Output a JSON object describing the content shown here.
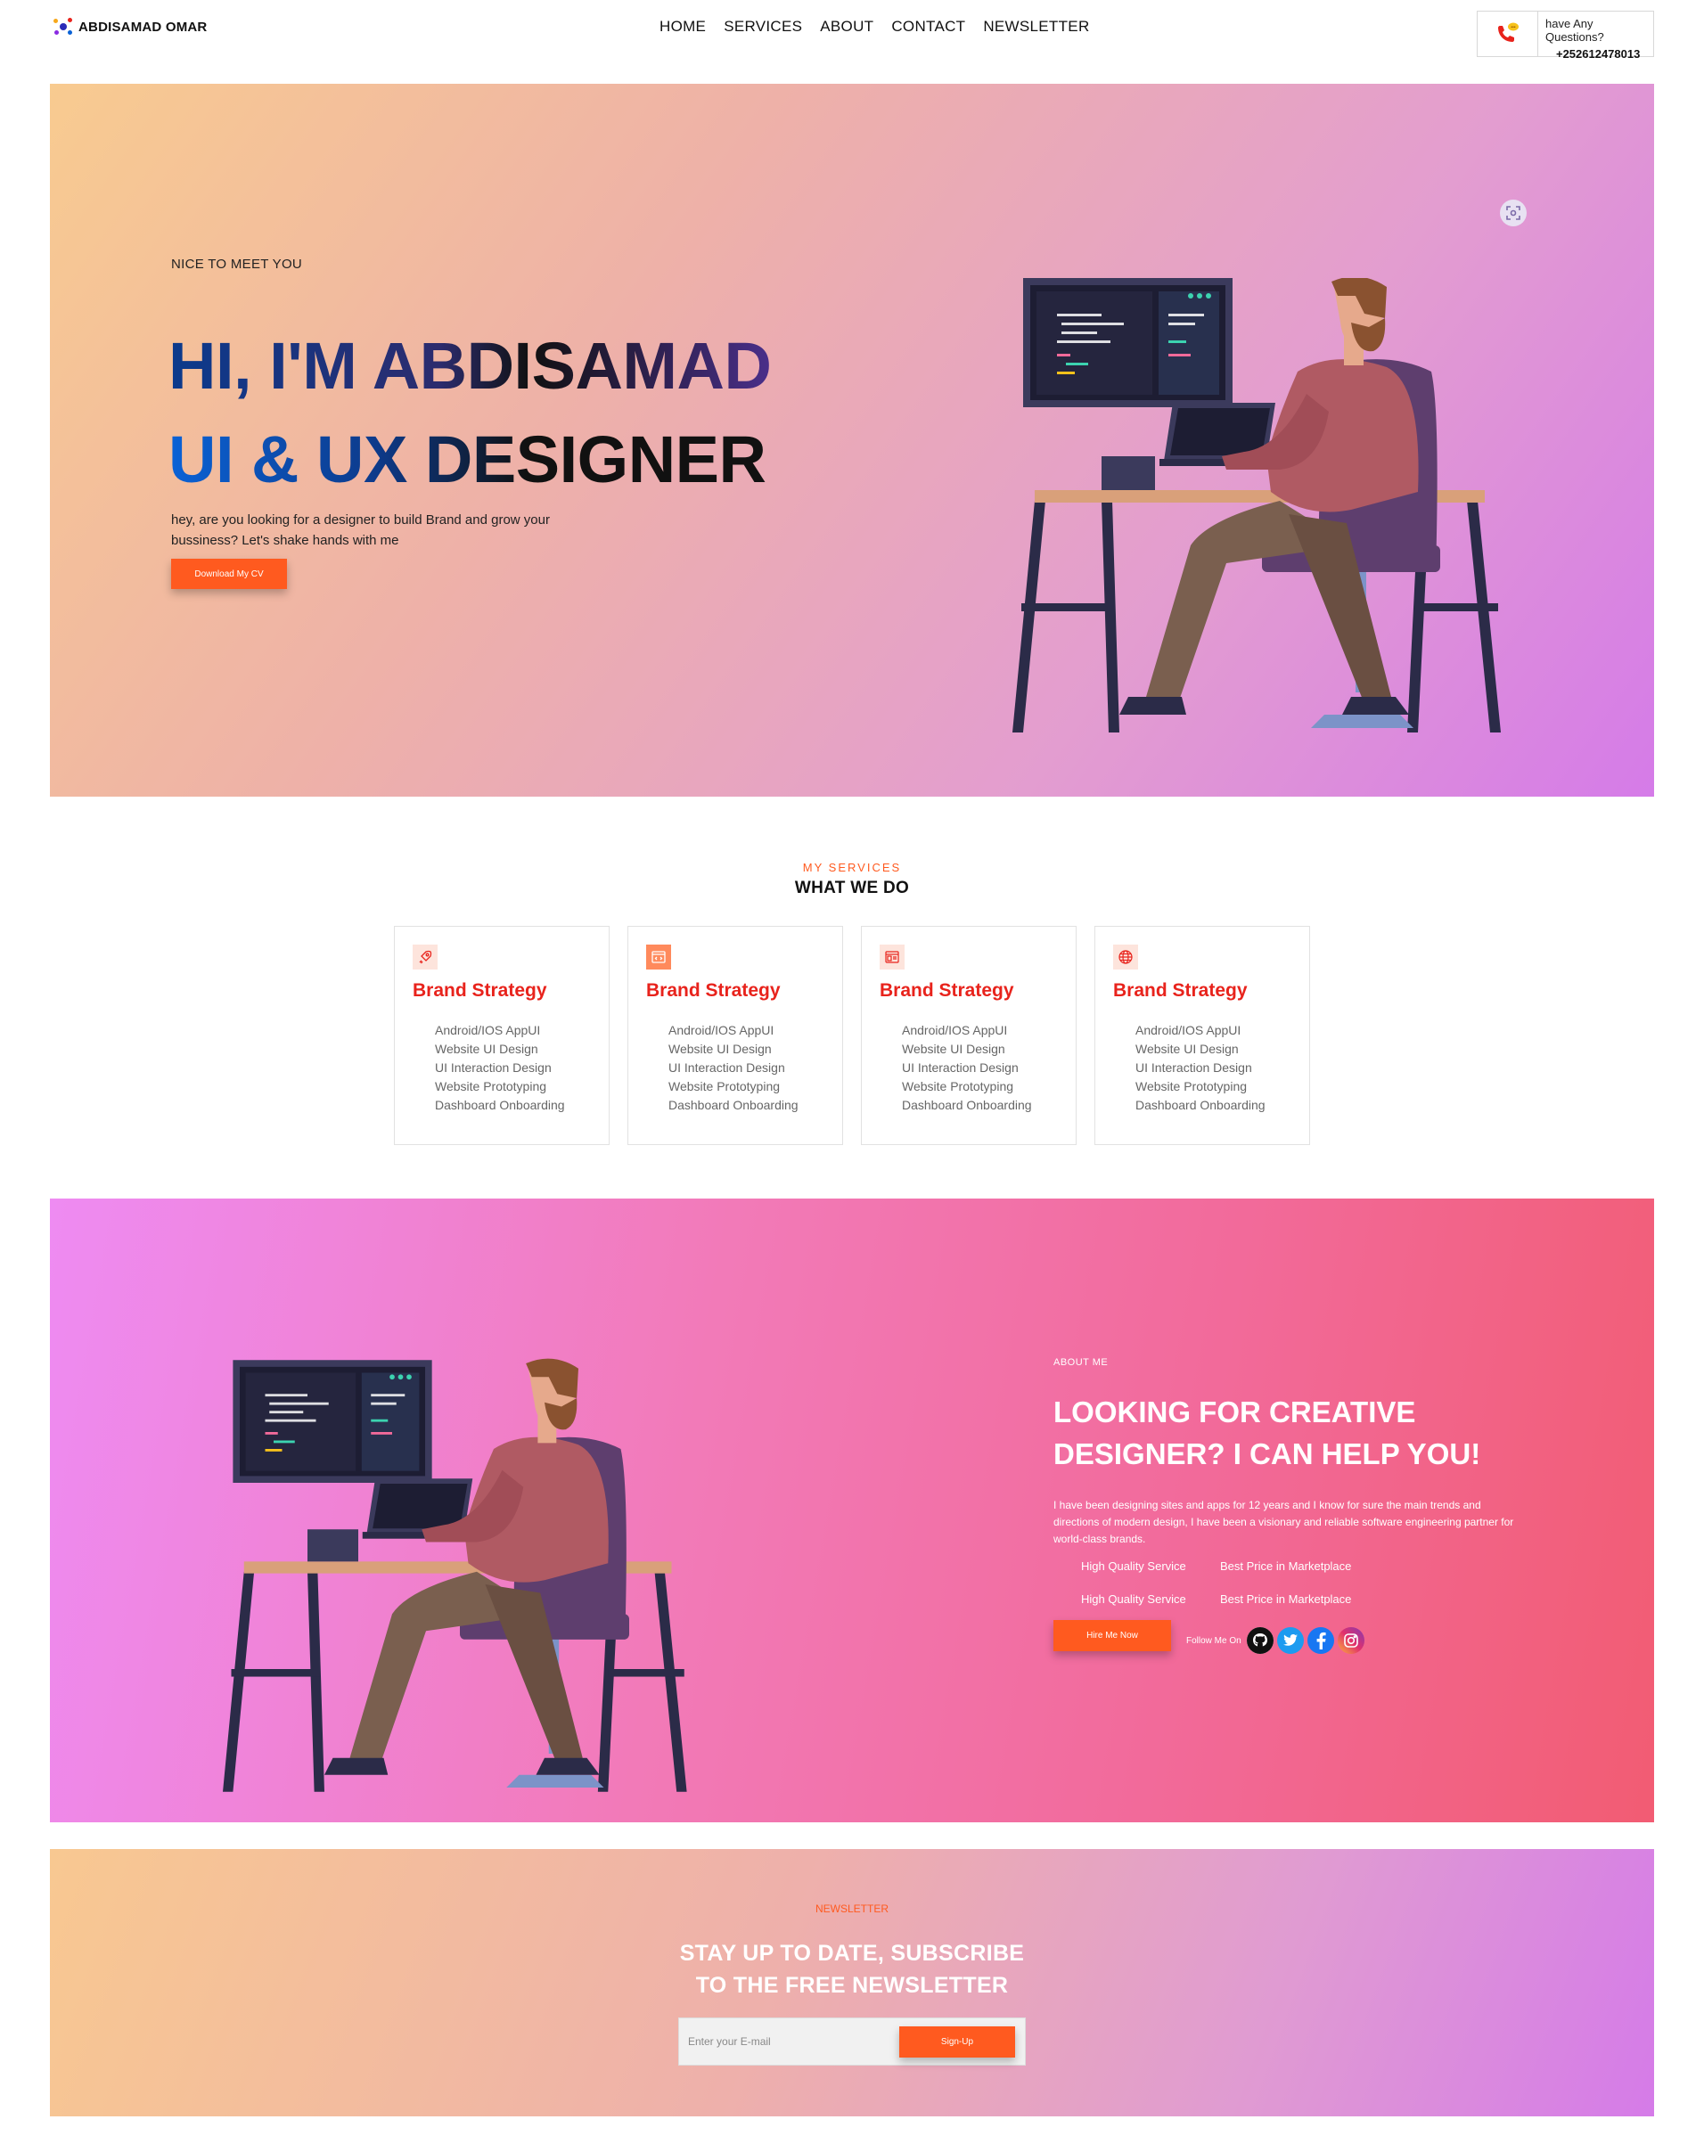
{
  "nav": {
    "brand": "ABDISAMAD OMAR",
    "menu": [
      "HOME",
      "SERVICES",
      "ABOUT",
      "CONTACT",
      "NEWSLETTER"
    ],
    "contact_question": "have Any Questions?",
    "contact_phone": "+252612478013"
  },
  "hero": {
    "kicker": "NICE TO MEET YOU",
    "headline_1": "HI, I'M ABDISAMAD",
    "headline_2": "UI & UX DESIGNER",
    "description": "hey, are you looking for a designer to build Brand and grow your bussiness? Let's shake hands with me",
    "cta": "Download My CV"
  },
  "services": {
    "kicker": "MY SERVICES",
    "title": "WHAT WE DO",
    "cards": [
      {
        "icon": "rocket-icon",
        "title": "Brand Strategy",
        "items": [
          "Android/IOS AppUI",
          "Website UI Design",
          "UI Interaction Design",
          "Website Prototyping",
          "Dashboard Onboarding"
        ]
      },
      {
        "icon": "code-window-icon",
        "title": "Brand Strategy",
        "items": [
          "Android/IOS AppUI",
          "Website UI Design",
          "UI Interaction Design",
          "Website Prototyping",
          "Dashboard Onboarding"
        ]
      },
      {
        "icon": "browser-layout-icon",
        "title": "Brand Strategy",
        "items": [
          "Android/IOS AppUI",
          "Website UI Design",
          "UI Interaction Design",
          "Website Prototyping",
          "Dashboard Onboarding"
        ]
      },
      {
        "icon": "globe-icon",
        "title": "Brand Strategy",
        "items": [
          "Android/IOS AppUI",
          "Website UI Design",
          "UI Interaction Design",
          "Website Prototyping",
          "Dashboard Onboarding"
        ]
      }
    ]
  },
  "about": {
    "kicker": "ABOUT ME",
    "title": "LOOKING FOR CREATIVE DESIGNER? I CAN HELP YOU!",
    "description": "I have been designing sites and apps for 12 years and I know for sure the main trends and directions of modern design, I have been a visionary and reliable software engineering partner for world-class brands.",
    "features": [
      "High Quality Service",
      "Best Price in Marketplace",
      "High Quality Service",
      "Best Price in Marketplace"
    ],
    "cta": "Hire Me Now",
    "follow_label": "Follow Me On",
    "socials": [
      "github-icon",
      "twitter-icon",
      "facebook-icon",
      "instagram-icon"
    ]
  },
  "newsletter": {
    "kicker": "NEWSLETTER",
    "title_1": "STAY UP TO DATE, SUBSCRIBE",
    "title_2": "TO THE FREE NEWSLETTER",
    "email_placeholder": "Enter your E-mail",
    "cta": "Sign-Up"
  },
  "colors": {
    "accent": "#ff5a1f",
    "service_title": "#e8231c",
    "hero_gradient": [
      "#f8cb90",
      "#d57be8"
    ],
    "about_gradient": [
      "#ee8bf2",
      "#f25c73"
    ]
  }
}
